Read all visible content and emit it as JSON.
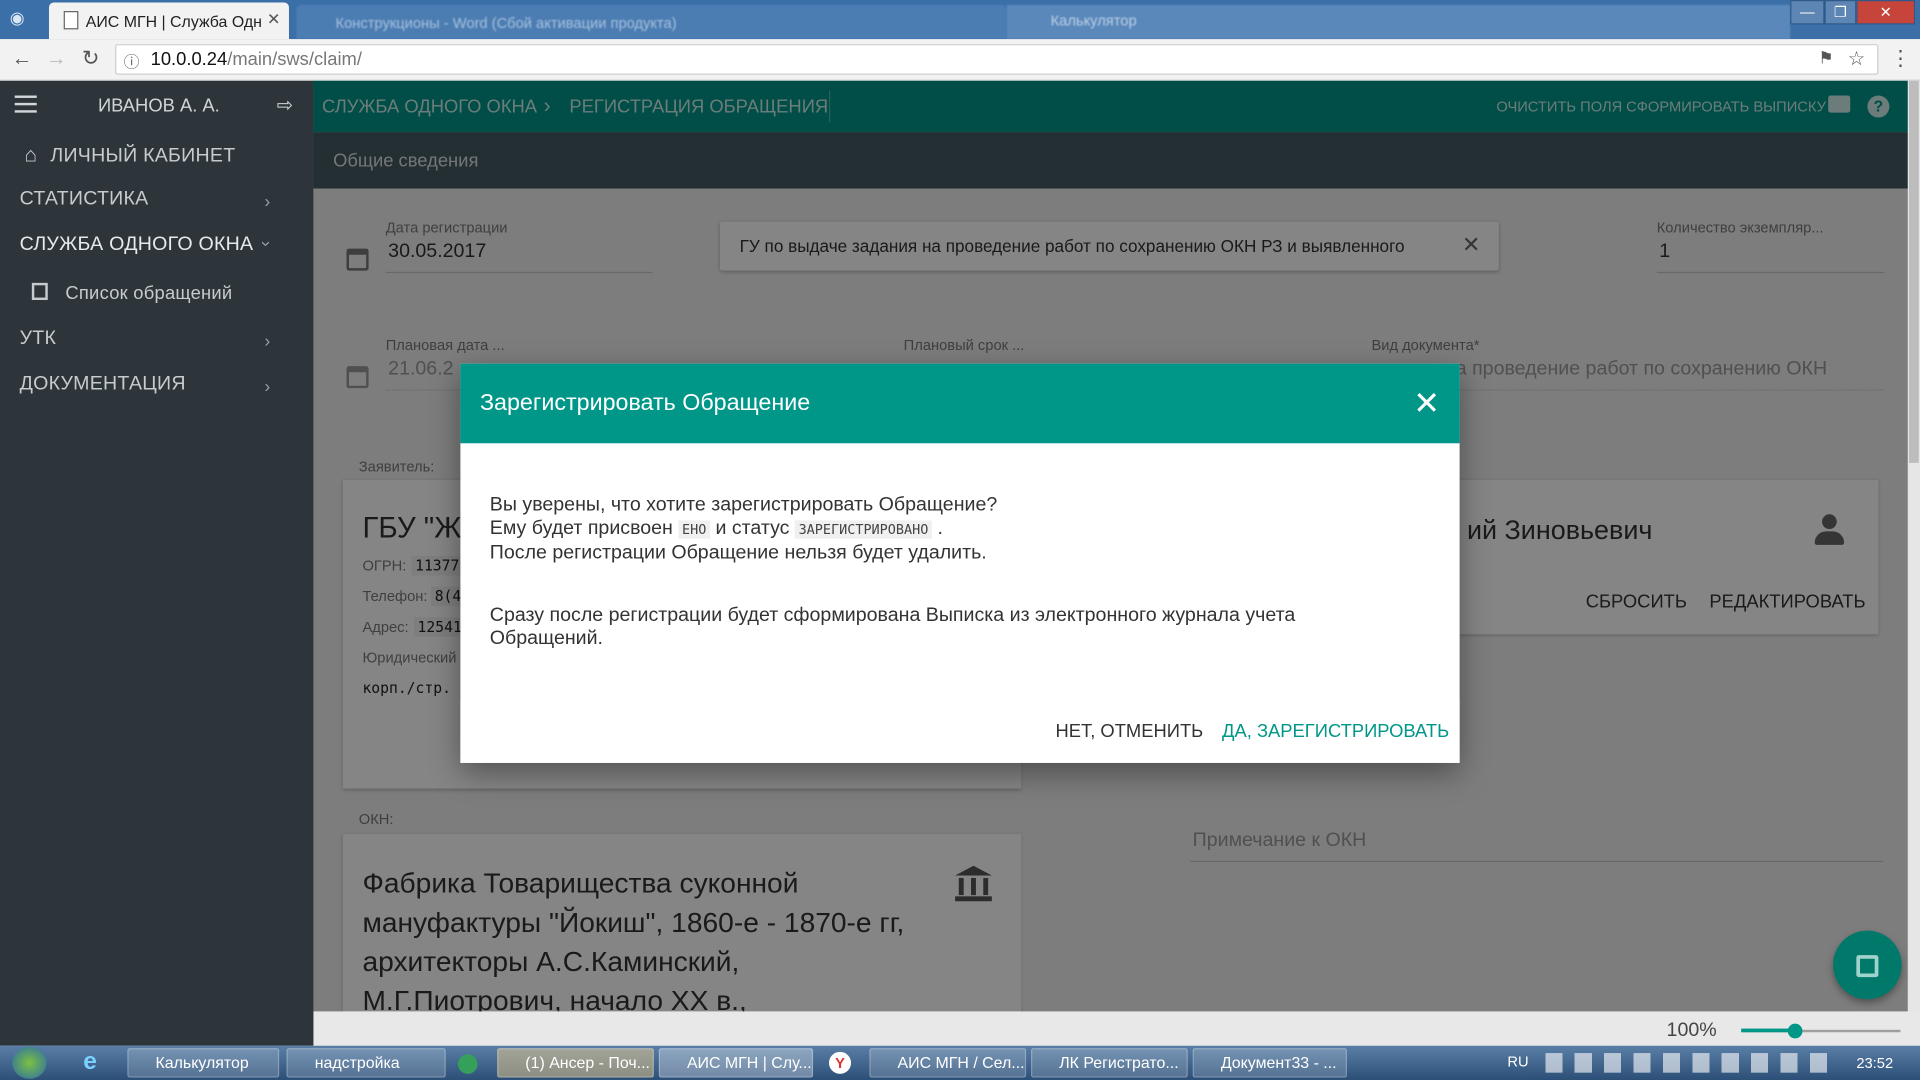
{
  "browser": {
    "tab_active_title": "АИС МГН | Служба Одн",
    "tab_word_title": "Конструкционы - Word (Сбой активации продукта)",
    "tab_other_title": "Калькулятор",
    "url_host": "10.0.0.24",
    "url_path": "/main/sws/claim/"
  },
  "sidebar": {
    "user_name": "ИВАНОВ А. А.",
    "items": [
      {
        "label": "ЛИЧНЫЙ КАБИНЕТ"
      },
      {
        "label": "СТАТИСТИКА"
      },
      {
        "label": "СЛУЖБА ОДНОГО ОКНА"
      },
      {
        "label": "Список обращений"
      },
      {
        "label": "УТК"
      },
      {
        "label": "ДОКУМЕНТАЦИЯ"
      }
    ]
  },
  "appbar": {
    "crumb1": "СЛУЖБА ОДНОГО ОКНА",
    "crumb2": "РЕГИСТРАЦИЯ ОБРАЩЕНИЯ",
    "clear_label": "ОЧИСТИТЬ ПОЛЯ",
    "extract_label": "СФОРМИРОВАТЬ ВЫПИСКУ"
  },
  "section_title": "Общие сведения",
  "form": {
    "reg_date_label": "Дата регистрации",
    "reg_date_value": "30.05.2017",
    "service_value": "ГУ по выдаче задания на проведение работ по сохранению ОКН РЗ и выявленного",
    "copies_label": "Количество экземпляр...",
    "copies_value": "1",
    "plan_date_label": "Плановая дата ...",
    "plan_date_value": "21.06.2",
    "plan_term_label": "Плановый срок ...",
    "doc_type_label": "Вид документа",
    "doc_type_value": "на проведение работ по сохранению ОКН",
    "applicant_label": "Заявитель:",
    "applicant_name": "ГБУ \"Ж",
    "ogrn_label": "ОГРН:",
    "ogrn_value": "11377",
    "phone_label": "Телефон:",
    "phone_value": "8(4",
    "address_label": "Адрес:",
    "address_value": "12541",
    "legal_label": "Юридический",
    "corp_value": "корп./стр.",
    "rep_name": "ий Зиновьевич",
    "reset_label": "СБРОСИТЬ",
    "edit_label": "РЕДАКТИРОВАТЬ",
    "okn_label": "ОКН:",
    "okn_title": "Фабрика Товарищества суконной мануфактуры \"Йокиш\", 1860-е - 1870-е гг, архитекторы А.С.Каминский, М.Г.Пиотрович, начало ХХ в.,",
    "okn_note_placeholder": "Примечание к ОКН"
  },
  "dialog": {
    "title": "Зарегистрировать Обращение",
    "line1": "Вы уверены, что хотите зарегистрировать Обращение?",
    "line2_pre": "Ему будет присвоен",
    "code1": "ЕНО",
    "line2_mid": "и статус",
    "code2": "ЗАРЕГИСТРИРОВАНО",
    "line2_post": ".",
    "line3": "После регистрации Обращение нельзя будет удалить.",
    "line4": "Сразу после регистрации будет сформирована Выписка из электронного журнала учета Обращений.",
    "cancel_label": "НЕТ, ОТМЕНИТЬ",
    "confirm_label": "ДА, ЗАРЕГИСТРИРОВАТЬ"
  },
  "status": {
    "zoom": "100%"
  },
  "taskbar": {
    "items": [
      {
        "label": "Калькулятор"
      },
      {
        "label": "надстройка"
      },
      {
        "label": "(1) Ансер - Поч..."
      },
      {
        "label": "АИС МГН | Слу..."
      },
      {
        "label": "АИС МГН / Сел..."
      },
      {
        "label": "ЛК Регистрато..."
      },
      {
        "label": "Документ33 - ..."
      }
    ],
    "lang": "RU",
    "time": "23:52"
  },
  "colors": {
    "teal": "#009688",
    "sidebar": "#2d353a",
    "subbar": "#455a64"
  }
}
